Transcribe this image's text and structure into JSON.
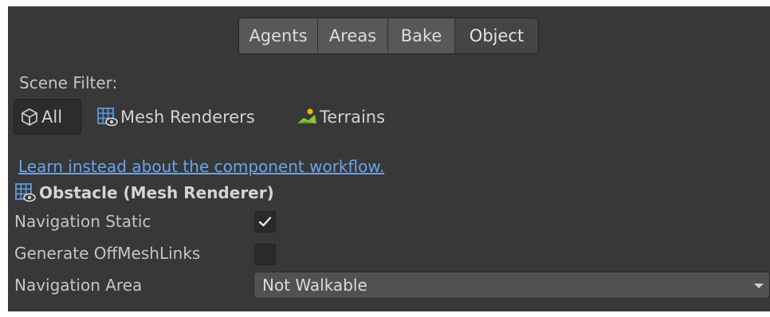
{
  "tabs": [
    {
      "label": "Agents",
      "active": false
    },
    {
      "label": "Areas",
      "active": false
    },
    {
      "label": "Bake",
      "active": false
    },
    {
      "label": "Object",
      "active": true
    }
  ],
  "scene_filter": {
    "label": "Scene Filter:",
    "options": [
      {
        "label": "All",
        "icon": "cube-icon",
        "selected": true
      },
      {
        "label": "Mesh Renderers",
        "icon": "mesh-renderer-icon",
        "selected": false
      },
      {
        "label": "Terrains",
        "icon": "terrain-icon",
        "selected": false
      }
    ]
  },
  "learn_link": "Learn instead about the component workflow.",
  "object": {
    "title": "Obstacle (Mesh Renderer)",
    "icon": "mesh-renderer-icon",
    "navigation_static": {
      "label": "Navigation Static",
      "checked": true
    },
    "generate_offmeshlinks": {
      "label": "Generate OffMeshLinks",
      "checked": false
    },
    "navigation_area": {
      "label": "Navigation Area",
      "value": "Not Walkable"
    }
  },
  "colors": {
    "panel_bg": "#383838",
    "link": "#6ba3e8",
    "text": "#c4c4c4"
  }
}
